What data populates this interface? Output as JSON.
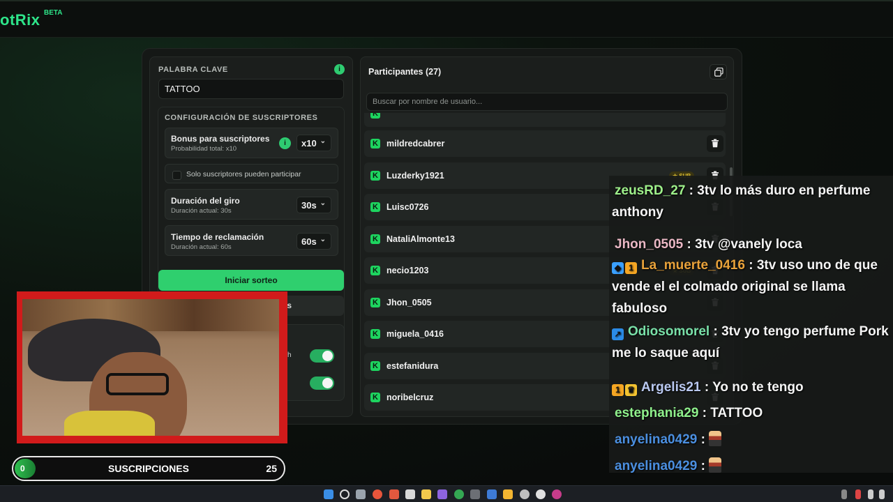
{
  "app": {
    "logo_text": "otRix",
    "beta_label": "BETA"
  },
  "keyword": {
    "label": "PALABRA CLAVE",
    "info": "i",
    "value": "TATTOO"
  },
  "subscriber_config": {
    "title": "CONFIGURACIÓN DE SUSCRIPTORES",
    "bonus": {
      "title": "Bonus para suscriptores",
      "subtitle": "Probabilidad total: x10",
      "info": "i",
      "value": "x10"
    },
    "only_subs_label": "Solo suscriptores pueden participar",
    "spin_duration": {
      "title": "Duración del giro",
      "subtitle": "Duración actual: 30s",
      "value": "30s"
    },
    "claim_time": {
      "title": "Tiempo de reclamación",
      "subtitle": "Duración actual: 60s",
      "value": "60s"
    }
  },
  "buttons": {
    "start": "Iniciar sorteo",
    "second_visible_suffix": "s"
  },
  "toggles": {
    "first_label_suffix": "ch",
    "first_on": true,
    "second_on": true
  },
  "participants": {
    "title": "Participantes (27)",
    "search_placeholder": "Buscar por nombre de usuario...",
    "sub_badge": "★ SUB",
    "rows": [
      {
        "name": "mildredcabrer",
        "sub": false
      },
      {
        "name": "Luzderky1921",
        "sub": true
      },
      {
        "name": "Luisc0726",
        "sub": false
      },
      {
        "name": "NataliAlmonte13",
        "sub": false
      },
      {
        "name": "necio1203",
        "sub": true
      },
      {
        "name": "Jhon_0505",
        "sub": false
      },
      {
        "name": "miguela_0416",
        "sub": false
      },
      {
        "name": "estefanidura",
        "sub": false
      },
      {
        "name": "noribelcruz",
        "sub": false
      }
    ]
  },
  "chat": [
    {
      "user": "zeusRD_27",
      "color": "#9ef08a",
      "text": " : 3tv lo más duro en perfume anthony",
      "badges": []
    },
    {
      "user": "Jhon_0505",
      "color": "#e9b7c4",
      "text": " : 3tv @vanely loca",
      "badges": []
    },
    {
      "user": "La_muerte_0416",
      "color": "#e8a23a",
      "text": " : 3tv uso uno de que vende el el colmado original se llama fabuloso",
      "badges": [
        "cube",
        "one"
      ]
    },
    {
      "user": "Odiosomorel",
      "color": "#79e0a8",
      "text": " : 3tv yo tengo perfume Pork me lo saque aquí",
      "badges": [
        "prime"
      ]
    },
    {
      "user": "Argelis21",
      "color": "#b9c8f0",
      "text": " : Yo no te tengo",
      "badges": [
        "one",
        "crown"
      ]
    },
    {
      "user": "estephania29",
      "color": "#8ff08c",
      "text": " : TATTOO",
      "badges": []
    },
    {
      "user": "anyelina0429",
      "color": "#4b8fe0",
      "text": " : ",
      "badges": [],
      "emote": true
    },
    {
      "user": "anyelina0429",
      "color": "#4b8fe0",
      "text": " : ",
      "badges": [],
      "emote": true
    }
  ],
  "subs_goal": {
    "current": "0",
    "label": "SUSCRIPCIONES",
    "goal": "25",
    "progress": 0
  }
}
